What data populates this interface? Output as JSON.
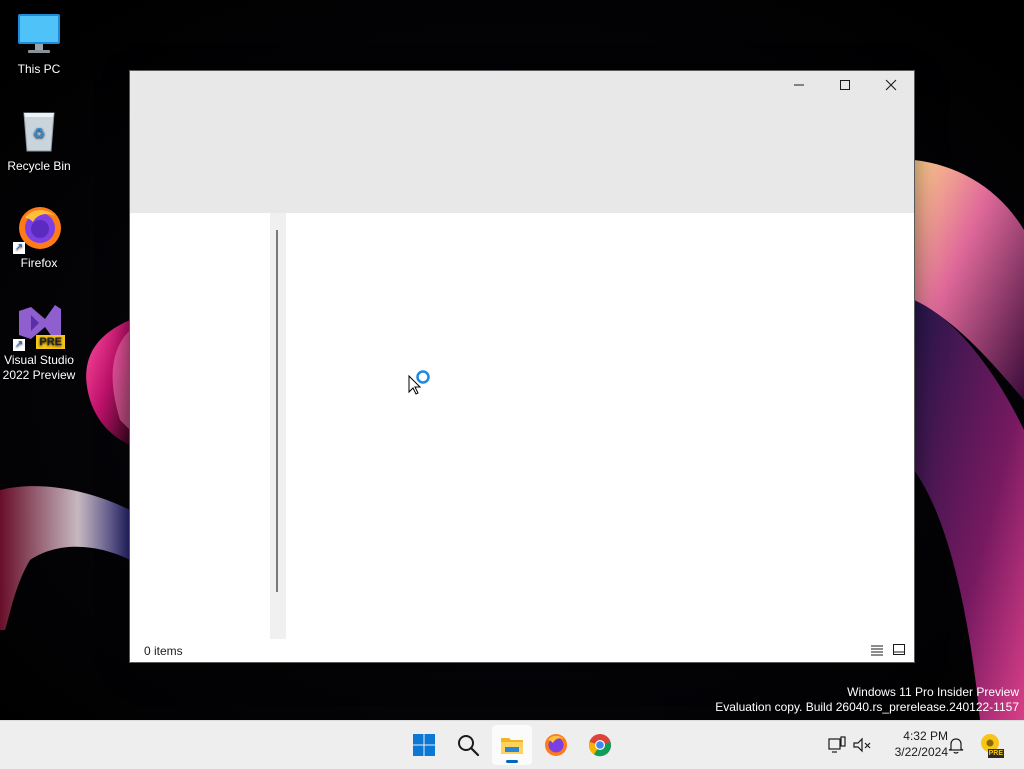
{
  "desktop": {
    "icons": [
      {
        "label": "This PC"
      },
      {
        "label": "Recycle Bin"
      },
      {
        "label": "Firefox"
      },
      {
        "label": "Visual Studio 2022 Preview",
        "badge": "PRE"
      }
    ]
  },
  "window": {
    "title": "",
    "status": {
      "item_count": "0 items"
    }
  },
  "watermark": {
    "line1": "Windows 11 Pro Insider Preview",
    "line2": "Evaluation copy. Build 26040.rs_prerelease.240122-1157"
  },
  "taskbar": {
    "apps": [
      {
        "name": "start",
        "icon": "windows-logo-icon"
      },
      {
        "name": "search",
        "icon": "search-icon"
      },
      {
        "name": "file-explorer",
        "icon": "folder-icon",
        "active": true
      },
      {
        "name": "firefox",
        "icon": "firefox-icon"
      },
      {
        "name": "chrome",
        "icon": "chrome-icon"
      }
    ],
    "clock": {
      "time": "4:32 PM",
      "date": "3/22/2024"
    },
    "tray_badge": "PRE"
  },
  "colors": {
    "accent": "#0067c0",
    "titlebar": "#e8e8e8",
    "taskbar": "#eeeeee"
  }
}
